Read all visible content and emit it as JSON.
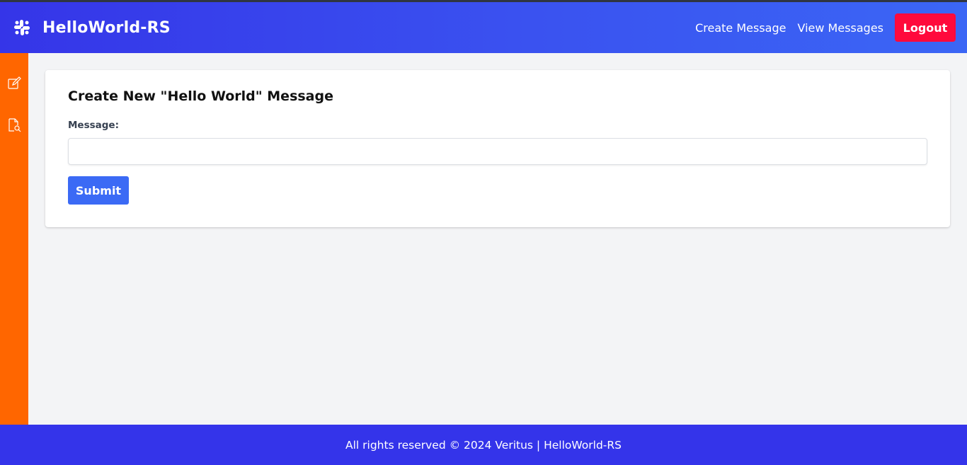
{
  "header": {
    "brand_icon": "slack-icon",
    "title": "HelloWorld-RS",
    "nav": [
      {
        "label": "Create Message"
      },
      {
        "label": "View Messages"
      }
    ],
    "logout_label": "Logout"
  },
  "sidebar": {
    "items": [
      {
        "icon": "edit-icon"
      },
      {
        "icon": "file-search-icon"
      }
    ]
  },
  "form": {
    "title": "Create New \"Hello World\" Message",
    "message_label": "Message:",
    "message_value": "",
    "submit_label": "Submit"
  },
  "footer": {
    "text": "All rights reserved © 2024 Veritus | HelloWorld-RS"
  },
  "colors": {
    "header": "#3b52f0",
    "sidebar": "#ff6600",
    "logout": "#ff0a3c",
    "submit": "#3b6af5",
    "footer": "#3434ea",
    "background": "#f3f4f6"
  }
}
